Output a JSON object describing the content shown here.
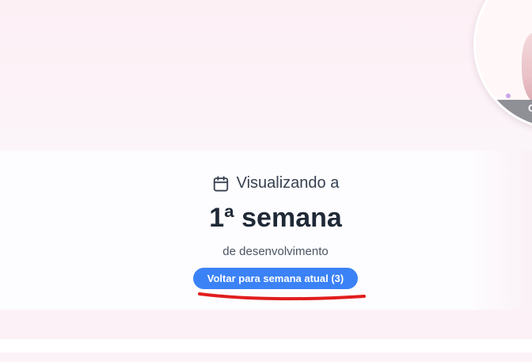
{
  "week_view": {
    "calendar_icon": "calendar-icon",
    "heading": "Visualizando a",
    "week_title": "1ª semana",
    "subtitle": "de desenvolvimento",
    "back_button_label": "Voltar para semana atual (3)"
  },
  "profile": {
    "strip_text": "C"
  },
  "colors": {
    "accent": "#3b82f6",
    "annotation": "#e11d1d",
    "heading_text": "#1f2937"
  }
}
